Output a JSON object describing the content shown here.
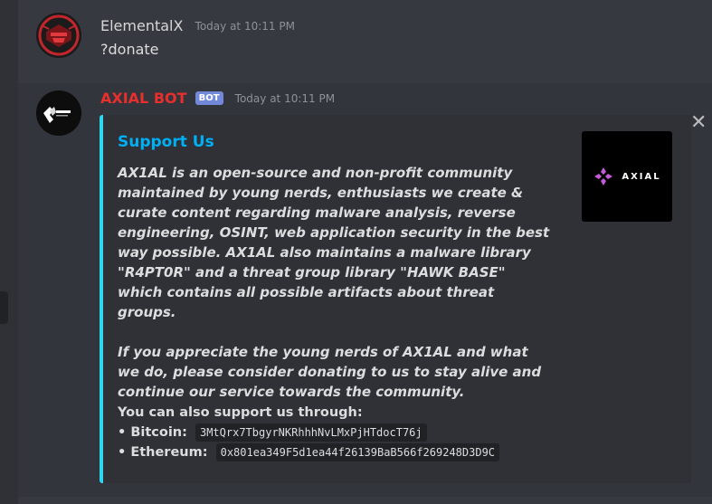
{
  "messages": [
    {
      "username": "ElementalX",
      "timestamp": "Today at 10:11 PM",
      "content": "?donate"
    },
    {
      "username": "AXIAL BOT",
      "bot_tag": "BOT",
      "timestamp": "Today at 10:11 PM",
      "embed": {
        "accent_color": "#2fd6f0",
        "title": "Support Us",
        "description_p1": "AX1AL is an open-source and non-profit community maintained by young nerds, enthusiasts we create & curate content regarding malware analysis, reverse engineering, OSINT, web application security in the best way possible. AX1AL also maintains a malware library \"R4PT0R\" and a threat group library \"HAWK BASE\" which contains all possible artifacts about threat groups.",
        "description_p2": "If you appreciate the young nerds of AX1AL and what we do, please consider donating to us to stay alive and continue our service towards the community.",
        "support_heading": "You can also support us through:",
        "bitcoin_label": "• Bitcoin:",
        "bitcoin_address": "3MtQrx7TbgyrNKRhhhNvLMxPjHTdocT76j",
        "ethereum_label": "• Ethereum:",
        "ethereum_address": "0x801ea349F5d1ea44f26139BaB566f269248D3D9C",
        "thumbnail_text": "AXIAL"
      }
    }
  ],
  "icons": {
    "close": "close-icon"
  }
}
